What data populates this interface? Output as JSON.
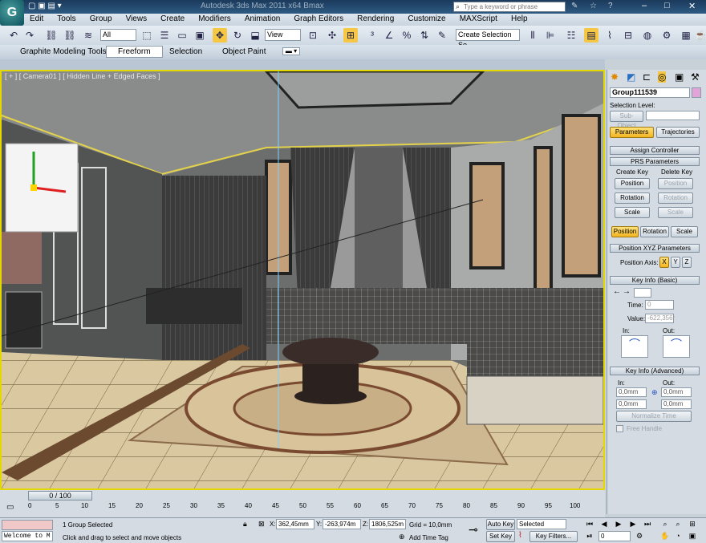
{
  "window": {
    "title": "Autodesk 3ds Max 2011 x64    Bmax"
  },
  "search": {
    "placeholder": "Type a keyword or phrase"
  },
  "menu": [
    "Edit",
    "Tools",
    "Group",
    "Views",
    "Create",
    "Modifiers",
    "Animation",
    "Graph Editors",
    "Rendering",
    "Customize",
    "MAXScript",
    "Help"
  ],
  "toolbar": {
    "selection_filter": "All",
    "ref_coord": "View",
    "named_selection": "Create Selection Se"
  },
  "ribbon": {
    "tabs": [
      "Graphite Modeling Tools",
      "Freeform",
      "Selection",
      "Object Paint"
    ]
  },
  "viewport": {
    "label": "[ + ] [ Camera01 ] [ Hidden Line + Edged Faces ]"
  },
  "panel": {
    "object_name": "Group111539",
    "selection_level": "Selection Level:",
    "sub_object": "Sub-Object",
    "tab_parameters": "Parameters",
    "tab_trajectories": "Trajectories",
    "assign_controller": "Assign Controller",
    "prs_parameters": "PRS Parameters",
    "create_key": "Create Key",
    "delete_key": "Delete Key",
    "position": "Position",
    "rotation": "Rotation",
    "scale": "Scale",
    "pos_xyz": "Position XYZ Parameters",
    "position_axis": "Position Axis:",
    "axis_x": "X",
    "axis_y": "Y",
    "axis_z": "Z",
    "key_info_basic": "Key Info (Basic)",
    "time_label": "Time:",
    "time_value": "0",
    "value_label": "Value:",
    "value_value": "-622,356r",
    "in_label": "In:",
    "out_label": "Out:",
    "key_info_adv": "Key Info (Advanced)",
    "in_value": "0,0mm",
    "out_value": "0,0mm",
    "normalize_time": "Normalize Time",
    "free_handle": "Free Handle"
  },
  "timeline": {
    "slider": "0 / 100",
    "ticks": [
      "0",
      "5",
      "10",
      "15",
      "20",
      "25",
      "30",
      "35",
      "40",
      "45",
      "50",
      "55",
      "60",
      "65",
      "70",
      "75",
      "80",
      "85",
      "90",
      "95",
      "100"
    ]
  },
  "status": {
    "script": "Welcome to M",
    "selected": "1 Group Selected",
    "prompt": "Click and drag to select and move objects",
    "x_label": "X:",
    "x": "362,45mm",
    "y_label": "Y:",
    "y": "-263,974m",
    "z_label": "Z:",
    "z": "1806,525m",
    "grid": "Grid = 10,0mm",
    "add_time_tag": "Add Time Tag",
    "auto_key": "Auto Key",
    "set_key": "Set Key",
    "key_mode": "Selected",
    "key_filters": "Key Filters...",
    "frame": "0"
  }
}
